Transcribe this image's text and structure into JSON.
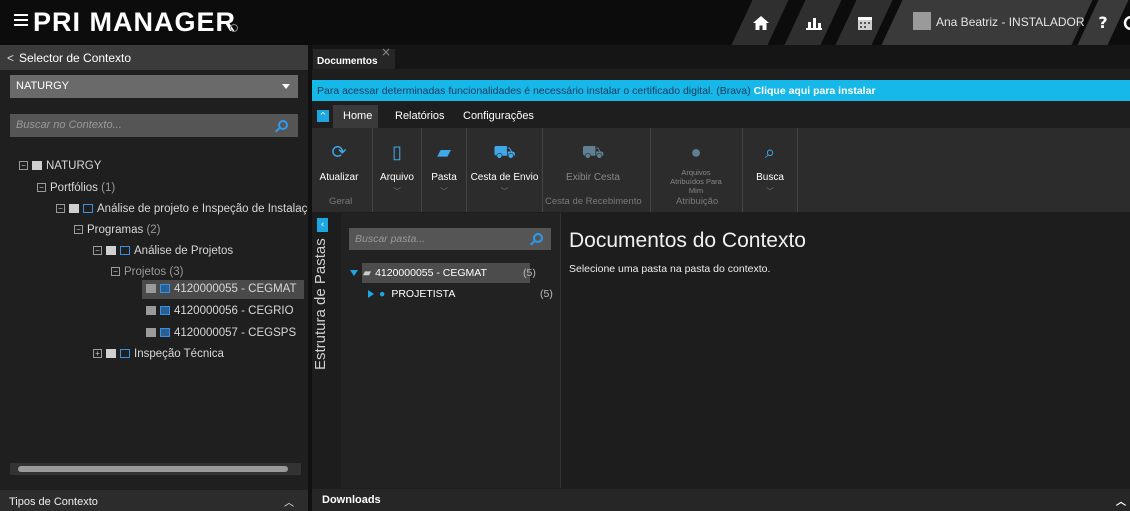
{
  "app": {
    "brand": "PRI MANAGER"
  },
  "topbar": {
    "user_name": "Ana Beatriz - INSTALADOR",
    "help_label": "?",
    "icons": [
      "home-icon",
      "chart-icon",
      "calendar-icon",
      "user-icon",
      "help-icon"
    ]
  },
  "left_panel": {
    "header": "Selector de Contexto",
    "back_glyph": "<",
    "context_value": "NATURGY",
    "search_placeholder": "Buscar no Contexto...",
    "tree": {
      "root": "NATURGY",
      "portfolios": "Portfólios",
      "portfolios_count": "(1)",
      "project": "Análise de projeto e Inspeção de Instalaçõ",
      "programs": "Programas",
      "programs_count": "(2)",
      "program_1": "Análise de Projetos",
      "projects": "Projetos",
      "projects_count": "(3)",
      "items": [
        "4120000055 - CEGMAT",
        "4120000056 - CEGRIO",
        "4120000057 - CEGSPS"
      ],
      "program_2": "Inspeção Técnica"
    },
    "footer": "Tipos de Contexto"
  },
  "main": {
    "tab_label": "Documentos",
    "tab_close": "×",
    "banner_text": "Para acessar determinadas funcionalidades é necessário instalar o certificado digital. (Brava)",
    "banner_link": "Clique aqui para instalar",
    "ribbon_tabs": [
      "Home",
      "Relatórios",
      "Configurações"
    ],
    "ribbon_buttons": {
      "atualizar": "Atualizar",
      "arquivo": "Arquivo",
      "pasta": "Pasta",
      "cesta_envio": "Cesta de Envio",
      "exibir_cesta": "Exibir Cesta",
      "arquivos_atribuidos": "Arquivos Atribuídos Para Mim",
      "busca": "Busca"
    },
    "ribbon_groups": {
      "geral": "Geral",
      "recebimento": "Cesta de Recebimento",
      "atribuicao": "Atribuição"
    },
    "vertical_tab": "Estrutura de Pastas",
    "folder_search_placeholder": "Buscar pasta...",
    "folders": [
      {
        "name": "4120000055 - CEGMAT",
        "count": "(5)"
      },
      {
        "name": "PROJETISTA",
        "count": "(5)"
      }
    ],
    "content_title": "Documentos do Contexto",
    "content_message": "Selecione uma pasta na pasta do contexto.",
    "downloads_label": "Downloads"
  },
  "colors": {
    "accent": "#1ea6e0",
    "banner": "#16b7e9"
  }
}
